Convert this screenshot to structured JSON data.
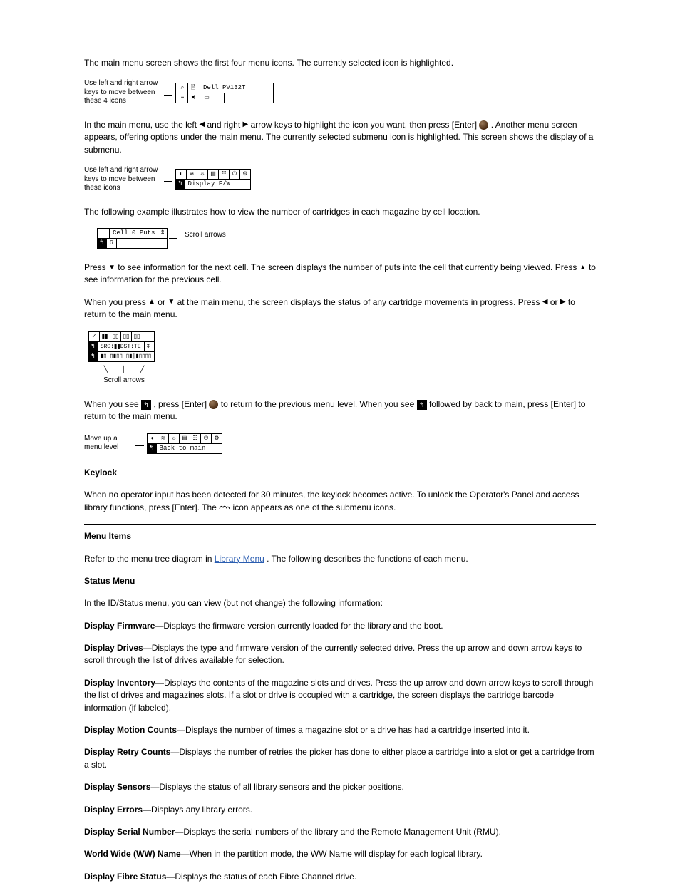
{
  "doc": {
    "p_intro": "The main menu screen shows the first four menu icons. The currently selected icon is highlighted.",
    "fig1": {
      "caption": "Use left and right arrow keys to move between these 4 icons",
      "title": "Dell PV132T",
      "icons_top": [
        "⌕",
        "🗎",
        "",
        ""
      ],
      "icons_bottom": [
        "≡",
        "✖",
        "▭",
        ""
      ]
    },
    "p_submenu_1": "In the main menu, use the left ",
    "p_submenu_2": " and right ",
    "p_submenu_3": " arrow keys to highlight the icon you want, then press [Enter] ",
    "p_submenu_4": " . Another menu screen appears, offering options under the main menu. The currently selected submenu icon is highlighted. This screen shows the display of a submenu.",
    "fig2": {
      "caption": "Use left and right arrow keys to move between these icons",
      "row_icons": [
        "◐",
        "≋",
        "☼",
        "▤",
        "☷",
        "⏻",
        "⚙"
      ],
      "back_icon": "↰",
      "label": "Display F/W"
    },
    "p_cell_intro": "The following example illustrates how to view the number of cartridges in each magazine by cell location.",
    "fig_cell": {
      "title": "Cell 0 Puts",
      "updown": "⇕",
      "back_icon": "↰",
      "value": "6",
      "scroll_label": "Scroll arrows"
    },
    "p_scroll_1": "Press ",
    "p_scroll_2": " to see information for the next cell. The screen displays the number of puts into the cell that currently being viewed. Press ",
    "p_scroll_3": " to see information for the previous cell.",
    "p_status_1": "When you press ",
    "p_status_2": " or ",
    "p_status_3": " at the main menu, the screen displays the status of any cartridge movements in progress. Press ",
    "p_status_4": " or ",
    "p_status_5": " to return to the main menu.",
    "fig_status": {
      "row1_icons": [
        "✓",
        "▮▮",
        "▯▯",
        "▯▯",
        "▯▯"
      ],
      "row2_left": "↰",
      "row2_mid": "SRC:▮▮DST:TE",
      "row2_right": "⇕",
      "row3_left": "↰",
      "row3_mid": "▮▯ ▯▮▯▯ ▯▮|▮▯▯▯▯",
      "scroll_label": "Scroll arrows"
    },
    "p_back_1": "When you see ",
    "p_back_2": " , press [Enter] ",
    "p_back_3": " to return to the previous menu level. When you see ",
    "p_back_4": " followed by back to main, press [Enter] to return to the main menu.",
    "fig_back": {
      "caption": "Move up a menu level",
      "row_icons": [
        "◐",
        "≋",
        "☼",
        "▤",
        "☷",
        "⏻",
        "⚙"
      ],
      "back_icon": "↰",
      "label": "Back to main"
    },
    "heading_keylock": "Keylock",
    "p_keylock_1": "When no operator input has been detected for 30 minutes, the keylock becomes active. To unlock the Operator's Panel and access library functions, press [Enter]. The ",
    "p_keylock_2": " icon appears as one of the submenu icons.",
    "heading_menu": "Menu Items",
    "p_menu_intro_1": "Refer to the menu tree diagram in ",
    "p_menu_link": "Library Menu",
    "p_menu_intro_2": ". The following describes the functions of each menu.",
    "heading_status": "Status Menu",
    "p_status": "In the ID/Status menu, you can view (but not change) the following information:",
    "status_items": {
      "i1_t": "Display Firmware",
      "i1_d": "—Displays the firmware version currently loaded for the library and the boot.",
      "i2_t": "Display Drives",
      "i2_d": "—Displays the type and firmware version of the currently selected drive. Press the up arrow and down arrow keys to scroll through the list of drives available for selection.",
      "i3_t": "Display Inventory",
      "i3_d": "—Displays the contents of the magazine slots and drives. Press the up arrow and down arrow keys to scroll through the list of drives and magazines slots. If a slot or drive is occupied with a cartridge, the screen displays the cartridge barcode information (if labeled).",
      "i4_t": "Display Motion Counts",
      "i4_d": "—Displays the number of times a magazine slot or a drive has had a cartridge inserted into it.",
      "i5_t": "Display Retry Counts",
      "i5_d": "—Displays the number of retries the picker has done to either place a cartridge into a slot or get a cartridge from a slot.",
      "i6_t": "Display Sensors",
      "i6_d": "—Displays the status of all library sensors and the picker positions.",
      "i7_t": "Display Errors",
      "i7_d": "—Displays any library errors.",
      "i8_t": "Display Serial Number",
      "i8_d": "—Displays the serial numbers of the library and the Remote Management Unit (RMU).",
      "i9_t": "World Wide (WW) Name",
      "i9_d": "—When in the partition mode, the WW Name will display for each logical library.",
      "i10_t": "Display Fibre Status",
      "i10_d": "—Displays the status of each Fibre Channel drive."
    }
  }
}
